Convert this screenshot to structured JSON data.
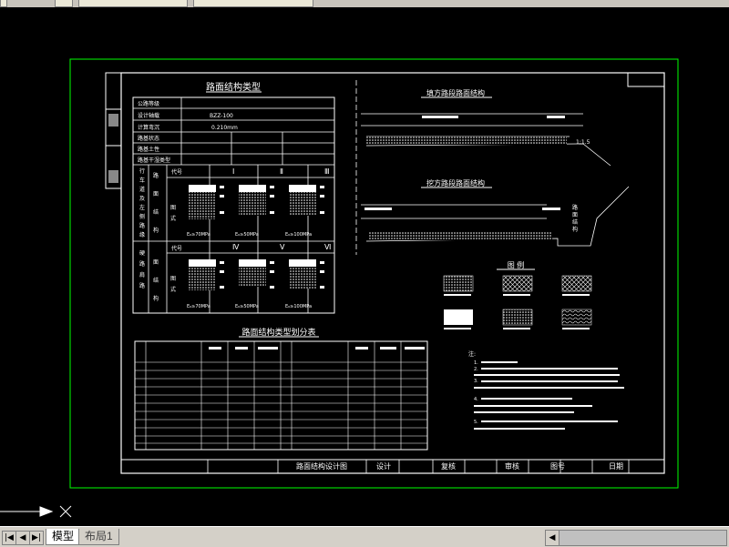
{
  "toolbar": {
    "labels": []
  },
  "drawing": {
    "frame_title": "路面结构设计图",
    "left_table": {
      "title": "路面结构类型",
      "rows": [
        "公路等级",
        "设计轴载",
        "计算弯沉",
        "路基状态",
        "路基土性",
        "路基干湿类型"
      ],
      "axle_value": "BZZ-100",
      "deflection_value": "0.210mm",
      "col_heads": [
        "Ⅰ",
        "Ⅱ",
        "Ⅲ"
      ],
      "lower_heads": [
        "Ⅳ",
        "Ⅴ",
        "Ⅵ"
      ],
      "code_label": "代号",
      "diagram_label": "图式",
      "modulus_labels": [
        "E₀≥70MPa",
        "E₀≥50MPa",
        "E₀≥100MPa"
      ]
    },
    "bottom_table": {
      "title": "路面结构类型划分表"
    },
    "sections": {
      "upper_title": "填方路段路面结构",
      "lower_title": "挖方路段路面结构",
      "slope": "1:1.5"
    },
    "legend": {
      "title": "图 例"
    },
    "notes": {
      "title": "注:",
      "items": [
        "1.",
        "2.",
        "3.",
        "4.",
        "5."
      ]
    },
    "title_block": {
      "design": "设计",
      "review": "复核",
      "audit": "审核",
      "number": "图号",
      "date": "日期"
    }
  },
  "status": {
    "tabs": [
      {
        "label": "模型",
        "active": true
      },
      {
        "label": "布局1",
        "active": false
      }
    ]
  }
}
